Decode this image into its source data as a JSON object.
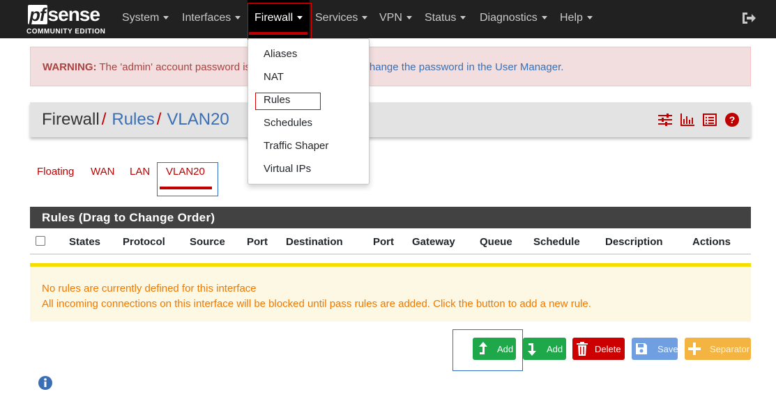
{
  "navbar": {
    "logo_pf": "pf",
    "logo_sense": "sense",
    "logo_sub": "COMMUNITY EDITION",
    "items": [
      {
        "label": "System"
      },
      {
        "label": "Interfaces"
      },
      {
        "label": "Firewall"
      },
      {
        "label": "Services"
      },
      {
        "label": "VPN"
      },
      {
        "label": "Status"
      },
      {
        "label": "Diagnostics"
      },
      {
        "label": "Help"
      }
    ],
    "active_item": "Firewall",
    "logout_icon": "sign-out-icon"
  },
  "dropdown": {
    "items": [
      "Aliases",
      "NAT",
      "Rules",
      "Schedules",
      "Traffic Shaper",
      "Virtual IPs"
    ],
    "highlighted": "Rules"
  },
  "warning": {
    "prefix": "WARNING:",
    "text": " The 'admin' account password is",
    "link": "Change the password in the User Manager."
  },
  "breadcrumb": {
    "root": "Firewall",
    "separator": "/",
    "level1": "Rules",
    "level2": "VLAN20",
    "icons": [
      "sliders-icon",
      "bar-chart-icon",
      "list-icon",
      "help-icon"
    ]
  },
  "tabs": {
    "items": [
      "Floating",
      "WAN",
      "LAN",
      "VLAN20"
    ],
    "active": "VLAN20"
  },
  "rules_panel": {
    "title": "Rules (Drag to Change Order)",
    "columns": [
      "States",
      "Protocol",
      "Source",
      "Port",
      "Destination",
      "Port",
      "Gateway",
      "Queue",
      "Schedule",
      "Description",
      "Actions"
    ]
  },
  "notice": {
    "line1": "No rules are currently defined for this interface",
    "line2": "All incoming connections on this interface will be blocked until pass rules are added. Click the button to add a new rule."
  },
  "buttons": {
    "add_top": "Add",
    "add_bottom": "Add",
    "delete": "Delete",
    "save": "Save",
    "separator": "Separator"
  },
  "colors": {
    "navbar_bg": "#212121",
    "brand_red": "#c00000",
    "link_blue": "#3a6fb5",
    "success_green": "#1ea84a",
    "danger_red": "#cc0000",
    "save_blue": "#6f9fe0",
    "warning_orange": "#f3b441",
    "notice_text": "#f07800"
  },
  "info_icon": "info-circle-icon"
}
